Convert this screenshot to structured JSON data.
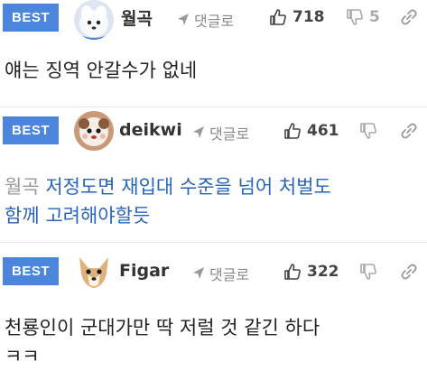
{
  "comments": [
    {
      "badge": "BEST",
      "nickname": "월곡",
      "reply_label": "댓글로",
      "likes": "718",
      "dislikes": "5",
      "body": "얘는 징역 안갈수가 없네"
    },
    {
      "badge": "BEST",
      "nickname": "deikwi",
      "reply_label": "댓글로",
      "likes": "461",
      "dislikes": "",
      "mention": "월곡",
      "body_line1": "저정도면 재입대 수준을 넘어 처벌도",
      "body_line2": "함께 고려해야할듯"
    },
    {
      "badge": "BEST",
      "nickname": "Figar",
      "reply_label": "댓글로",
      "likes": "322",
      "dislikes": "",
      "body_line1": "천룡인이 군대가만 딱 저럴 것 같긴 하다",
      "body_line2": "ㅋㅋ"
    }
  ],
  "colors": {
    "badge": "#4b86dc",
    "reply_text": "#2a63b8",
    "mention": "#999999"
  },
  "icons": [
    "arrow-icon",
    "thumbs-up-icon",
    "thumbs-down-icon",
    "link-icon"
  ]
}
